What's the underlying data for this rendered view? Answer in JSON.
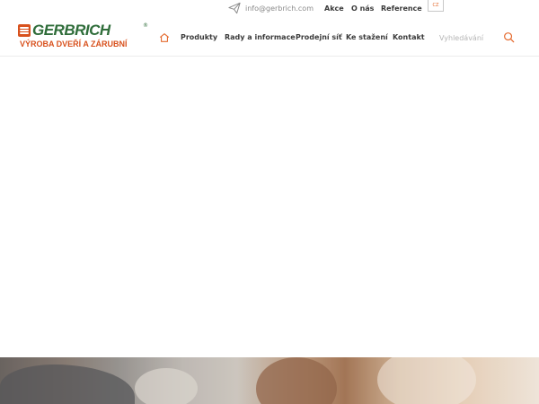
{
  "topbar": {
    "email_icon": "paper-plane-icon",
    "email": "info@gerbrich.com",
    "links": [
      {
        "label": "Akce"
      },
      {
        "label": "O nás"
      },
      {
        "label": "Reference"
      }
    ],
    "language": "CZ"
  },
  "brand": {
    "name": "GERBRICH",
    "registered": "®",
    "tagline": "VÝROBA DVEŘÍ A ZÁRUBNÍ",
    "colors": {
      "green": "#2f6d3a",
      "orange": "#d8511d"
    }
  },
  "nav": {
    "home_icon": "home-icon",
    "items": [
      {
        "label": "Produkty"
      },
      {
        "label": "Rady a informace"
      },
      {
        "label": "Prodejní síť"
      },
      {
        "label": "Ke stažení"
      },
      {
        "label": "Kontakt"
      }
    ]
  },
  "search": {
    "placeholder": "Vyhledávání",
    "icon": "search-icon"
  },
  "accent_color": "#e56a2e"
}
